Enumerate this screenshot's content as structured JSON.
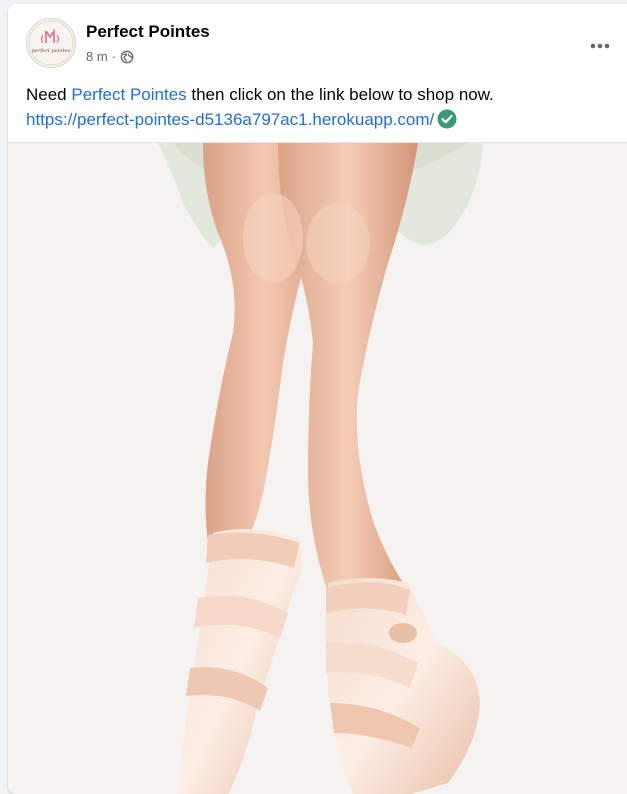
{
  "post": {
    "author": "Perfect Pointes",
    "avatar_text": "perfect pointes",
    "time": "8 m",
    "separator": "·",
    "privacy_icon": "globe-icon",
    "more_icon": "more-dots-icon",
    "text_before": "Need ",
    "text_mention": "Perfect Pointes",
    "text_after": " then click on the link below to shop now.",
    "url": "https://perfect-pointes-d5136a797ac1.herokuapp.com/",
    "verified_icon": "check-circle-icon",
    "image_icon": "ballet-pointe-shoes-photo"
  },
  "colors": {
    "link": "#216fdb",
    "verified": "#31a24c"
  }
}
